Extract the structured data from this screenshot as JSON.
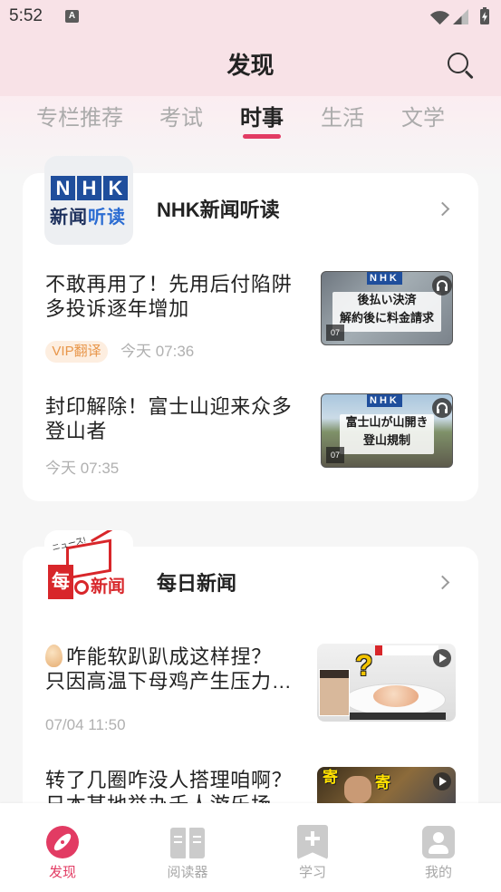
{
  "status_bar": {
    "time": "5:52",
    "notification_badge": "A",
    "icons": [
      "wifi-icon",
      "cell-signal-icon",
      "battery-charging-icon"
    ]
  },
  "header": {
    "title": "发现",
    "search_icon": "search-icon"
  },
  "tabs": [
    {
      "label": "专栏推荐",
      "active": false
    },
    {
      "label": "考试",
      "active": false
    },
    {
      "label": "时事",
      "active": true
    },
    {
      "label": "生活",
      "active": false
    },
    {
      "label": "文学",
      "active": false
    }
  ],
  "sections": [
    {
      "title": "NHK新闻听读",
      "logo": {
        "letters": [
          "N",
          "H",
          "K"
        ],
        "text_dark": "新闻",
        "text_blue": "听读"
      },
      "chevron_icon": "chevron-right-icon",
      "articles": [
        {
          "title_lines": [
            "不敢再用了！先用后付陷阱",
            "多投诉逐年增加"
          ],
          "badge": "VIP翻译",
          "time": "今天 07:36",
          "thumbnail": {
            "brand": "NHK",
            "caption_lines": [
              "後払い決済",
              "解約後に料金請求"
            ],
            "date": "07",
            "icon": "headphones-icon"
          }
        },
        {
          "title_lines": [
            "封印解除！富士山迎来众多",
            "登山者"
          ],
          "time": "今天 07:35",
          "thumbnail": {
            "brand": "NHK",
            "caption_lines": [
              "富士山が山開き",
              "登山規制"
            ],
            "date": "07",
            "icon": "headphones-icon"
          }
        }
      ]
    },
    {
      "title": "每日新闻",
      "logo": {
        "tagline": "ニュース!",
        "box_char": "每",
        "text": "新闻"
      },
      "chevron_icon": "chevron-right-icon",
      "articles": [
        {
          "leading_icon": "egg-emoji-icon",
          "title_lines": [
            "咋能软趴趴成这样捏？",
            "只因高温下母鸡产生压力…"
          ],
          "time": "07/04 11:50",
          "thumbnail": {
            "mark": "?",
            "icon": "play-icon"
          }
        },
        {
          "title_lines": [
            "转了几圈咋没人搭理咱啊？",
            "日本某地举办千人游乐场"
          ],
          "thumbnail": {
            "mark": "寄",
            "icon": "play-icon"
          }
        }
      ]
    }
  ],
  "bottom_nav": [
    {
      "label": "发现",
      "icon": "compass-icon",
      "active": true
    },
    {
      "label": "阅读器",
      "icon": "book-icon",
      "active": false
    },
    {
      "label": "学习",
      "icon": "bookmark-plus-icon",
      "active": false
    },
    {
      "label": "我的",
      "icon": "profile-icon",
      "active": false
    }
  ],
  "colors": {
    "accent": "#e23b63",
    "vip_text": "#e8964a",
    "vip_bg": "#fdeee0",
    "header_bg": "#f8e2e7",
    "nhk_blue": "#1f4e9c"
  }
}
